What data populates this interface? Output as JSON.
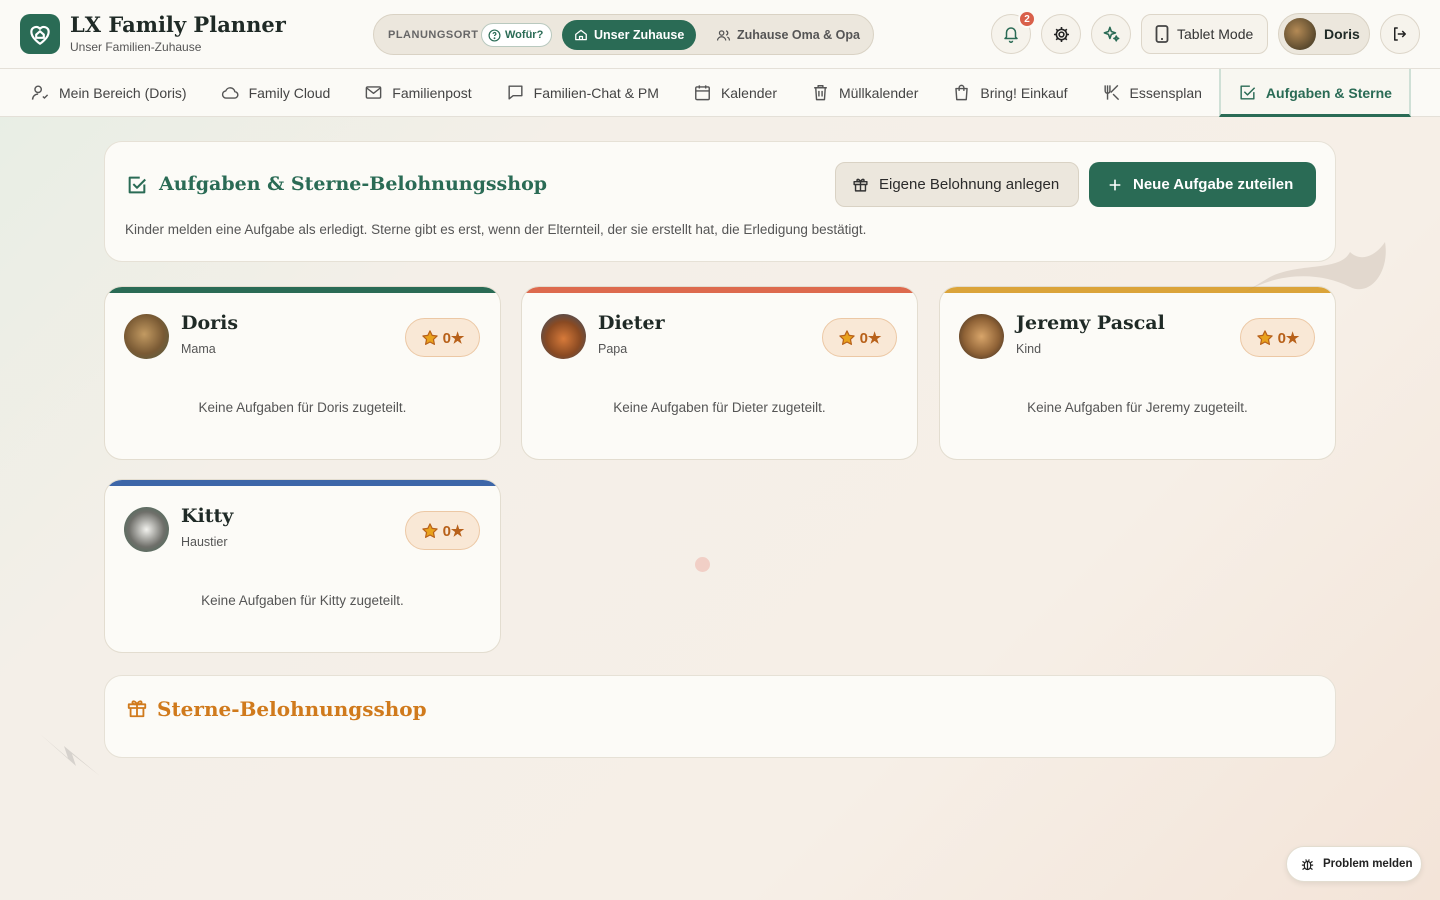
{
  "app": {
    "title": "LX Family Planner",
    "subtitle": "Unser Familien-Zuhause"
  },
  "planning": {
    "label": "PLANUNGSORT",
    "help": "Wofür?",
    "active": "Unser Zuhause",
    "other": "Zuhause Oma & Opa"
  },
  "header": {
    "notification_count": "2",
    "tablet_mode": "Tablet Mode",
    "user_name": "Doris"
  },
  "tabs": [
    {
      "label": "Mein Bereich (Doris)",
      "icon": "user-icon"
    },
    {
      "label": "Family Cloud",
      "icon": "cloud-icon"
    },
    {
      "label": "Familienpost",
      "icon": "mail-icon"
    },
    {
      "label": "Familien-Chat & PM",
      "icon": "chat-icon"
    },
    {
      "label": "Kalender",
      "icon": "calendar-icon"
    },
    {
      "label": "Müllkalender",
      "icon": "trash-icon"
    },
    {
      "label": "Bring! Einkauf",
      "icon": "shopping-bag-icon"
    },
    {
      "label": "Essensplan",
      "icon": "utensils-icon"
    },
    {
      "label": "Aufgaben & Sterne",
      "icon": "check-square-icon",
      "active": true
    }
  ],
  "main": {
    "title": "Aufgaben & Sterne-Belohnungsshop",
    "description": "Kinder melden eine Aufgabe als erledigt. Sterne gibt es erst, wenn der Elternteil, der sie erstellt hat, die Erledigung bestätigt.",
    "reward_button": "Eigene Belohnung anlegen",
    "new_task_button": "Neue Aufgabe zuteilen"
  },
  "members": [
    {
      "name": "Doris",
      "role": "Mama",
      "stars": "0★",
      "empty": "Keine Aufgaben für Doris zugeteilt.",
      "accent": "#2a6b55"
    },
    {
      "name": "Dieter",
      "role": "Papa",
      "stars": "0★",
      "empty": "Keine Aufgaben für Dieter zugeteilt.",
      "accent": "#dd6a4e"
    },
    {
      "name": "Jeremy Pascal",
      "role": "Kind",
      "stars": "0★",
      "empty": "Keine Aufgaben für Jeremy zugeteilt.",
      "accent": "#dba43a"
    },
    {
      "name": "Kitty",
      "role": "Haustier",
      "stars": "0★",
      "empty": "Keine Aufgaben für Kitty zugeteilt.",
      "accent": "#3d66a8"
    }
  ],
  "shop": {
    "title": "Sterne-Belohnungsshop"
  },
  "footer": {
    "problem_button": "Problem melden"
  },
  "colors": {
    "primary": "#2a6b55",
    "star": "#d88a1a",
    "shop_title": "#d07a1c"
  }
}
